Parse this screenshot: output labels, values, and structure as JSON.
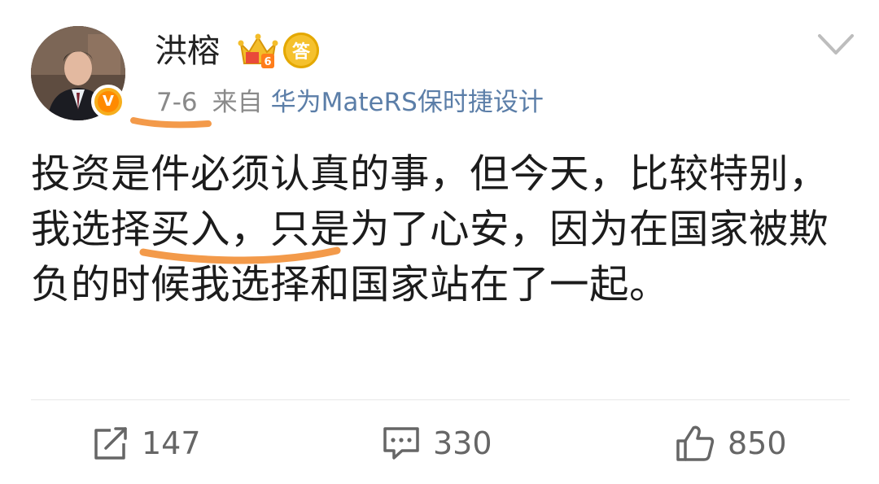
{
  "post": {
    "username": "洪榕",
    "badge_answer_char": "答",
    "badge_level": "6",
    "verified_mark": "V",
    "time": "7-6",
    "from_label": "来自",
    "source": "华为MateRS保时捷设计",
    "content": "投资是件必须认真的事，但今天，比较特别，我选择买入，只是为了心安，因为在国家被欺负的时候我选择和国家站在了一起。"
  },
  "actions": {
    "repost_count": "147",
    "comment_count": "330",
    "like_count": "850"
  },
  "colors": {
    "annotation_underline": "#f39a4a",
    "source_link": "#5b7ea8",
    "meta_gray": "#8a8a8a",
    "verified_badge": "#f6ae1d"
  },
  "icons": [
    "avatar-photo",
    "verified-icon",
    "crown-level-icon",
    "answer-badge-icon",
    "chevron-down-icon",
    "repost-icon",
    "comment-icon",
    "like-icon"
  ]
}
